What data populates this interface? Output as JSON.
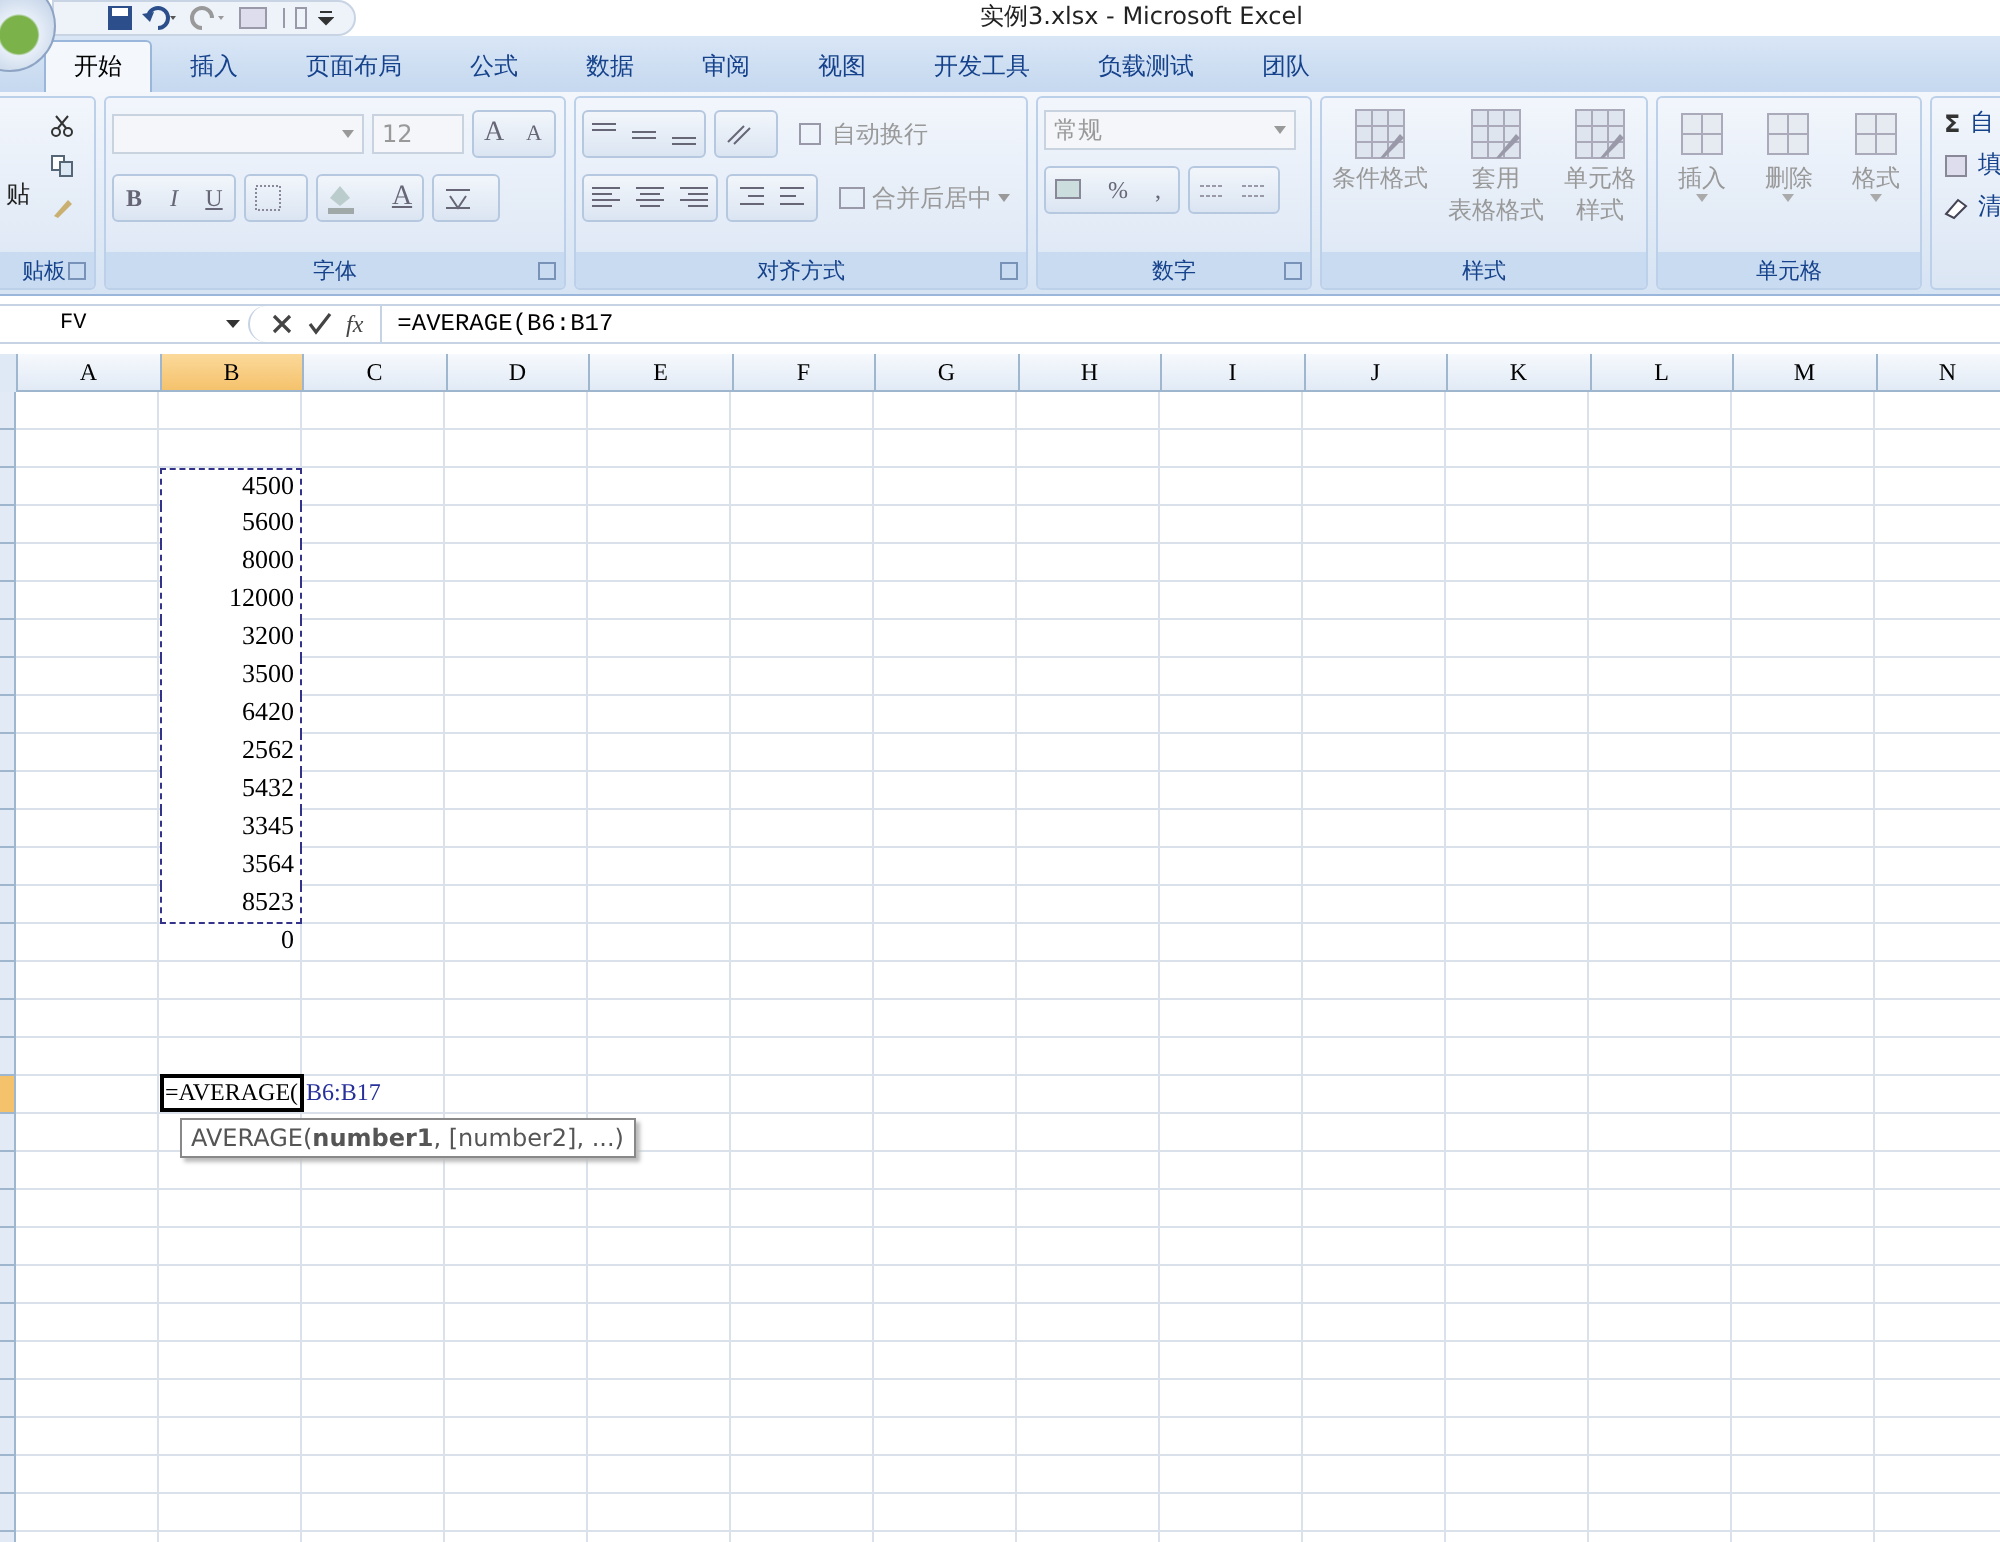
{
  "window": {
    "title": "实例3.xlsx - Microsoft Excel"
  },
  "tabs": [
    {
      "label": "开始",
      "selected": true
    },
    {
      "label": "插入",
      "selected": false
    },
    {
      "label": "页面布局",
      "selected": false
    },
    {
      "label": "公式",
      "selected": false
    },
    {
      "label": "数据",
      "selected": false
    },
    {
      "label": "审阅",
      "selected": false
    },
    {
      "label": "视图",
      "selected": false
    },
    {
      "label": "开发工具",
      "selected": false
    },
    {
      "label": "负载测试",
      "selected": false
    },
    {
      "label": "团队",
      "selected": false
    }
  ],
  "ribbon": {
    "clipboard": {
      "label": "贴板",
      "paste": "贴"
    },
    "font": {
      "label": "字体",
      "size": "12",
      "bold": "B",
      "italic": "I",
      "underline": "U",
      "font_color": "A",
      "grow": "A",
      "shrink": "A"
    },
    "alignment": {
      "label": "对齐方式",
      "wrap": "自动换行",
      "merge": "合并后居中"
    },
    "number": {
      "label": "数字",
      "format": "常规",
      "percent": "%",
      "comma": ","
    },
    "styles": {
      "label": "样式",
      "buttons": [
        {
          "lines": [
            "条件格式"
          ]
        },
        {
          "lines": [
            "套用",
            "表格格式"
          ]
        },
        {
          "lines": [
            "单元格",
            "样式"
          ]
        }
      ]
    },
    "cells": {
      "label": "单元格",
      "buttons": [
        "插入",
        "删除",
        "格式"
      ]
    },
    "editing": {
      "sum": "Σ",
      "items": [
        "自",
        "填",
        "清"
      ]
    }
  },
  "formula_bar": {
    "name_box": "FV",
    "fx": "fx",
    "formula": "=AVERAGE(B6:B17"
  },
  "sheet": {
    "columns": [
      {
        "label": "A",
        "selected": false
      },
      {
        "label": "B",
        "selected": true
      },
      {
        "label": "C",
        "selected": false
      },
      {
        "label": "D",
        "selected": false
      },
      {
        "label": "E",
        "selected": false
      },
      {
        "label": "F",
        "selected": false
      },
      {
        "label": "G",
        "selected": false
      },
      {
        "label": "H",
        "selected": false
      },
      {
        "label": "I",
        "selected": false
      },
      {
        "label": "J",
        "selected": false
      },
      {
        "label": "K",
        "selected": false
      },
      {
        "label": "L",
        "selected": false
      },
      {
        "label": "M",
        "selected": false
      },
      {
        "label": "N",
        "selected": false
      }
    ],
    "rows": [
      {
        "selected": false
      },
      {
        "selected": false
      },
      {
        "selected": false,
        "b": "4500",
        "marquee": true
      },
      {
        "selected": false,
        "b": "5600",
        "marquee": true
      },
      {
        "selected": false,
        "b": "8000",
        "marquee": true
      },
      {
        "selected": false,
        "b": "12000",
        "marquee": true
      },
      {
        "selected": false,
        "b": "3200",
        "marquee": true
      },
      {
        "selected": false,
        "b": "3500",
        "marquee": true
      },
      {
        "selected": false,
        "b": "6420",
        "marquee": true
      },
      {
        "selected": false,
        "b": "2562",
        "marquee": true
      },
      {
        "selected": false,
        "b": "5432",
        "marquee": true
      },
      {
        "selected": false,
        "b": "3345",
        "marquee": true
      },
      {
        "selected": false,
        "b": "3564",
        "marquee": true
      },
      {
        "selected": false,
        "b": "8523",
        "marquee": true
      },
      {
        "selected": false,
        "b": "0"
      },
      {
        "selected": false
      },
      {
        "selected": false
      },
      {
        "selected": false
      },
      {
        "selected": true,
        "editing": true
      },
      {
        "selected": false
      },
      {
        "selected": false
      },
      {
        "selected": false
      },
      {
        "selected": false
      },
      {
        "selected": false
      },
      {
        "selected": false
      },
      {
        "selected": false
      },
      {
        "selected": false
      },
      {
        "selected": false
      },
      {
        "selected": false
      },
      {
        "selected": false
      },
      {
        "selected": false
      }
    ],
    "cell_edit": {
      "function": "=AVERAGE(",
      "reference": "B6:B17"
    },
    "tooltip": "AVERAGE(**number1**, [number2], ...)"
  }
}
